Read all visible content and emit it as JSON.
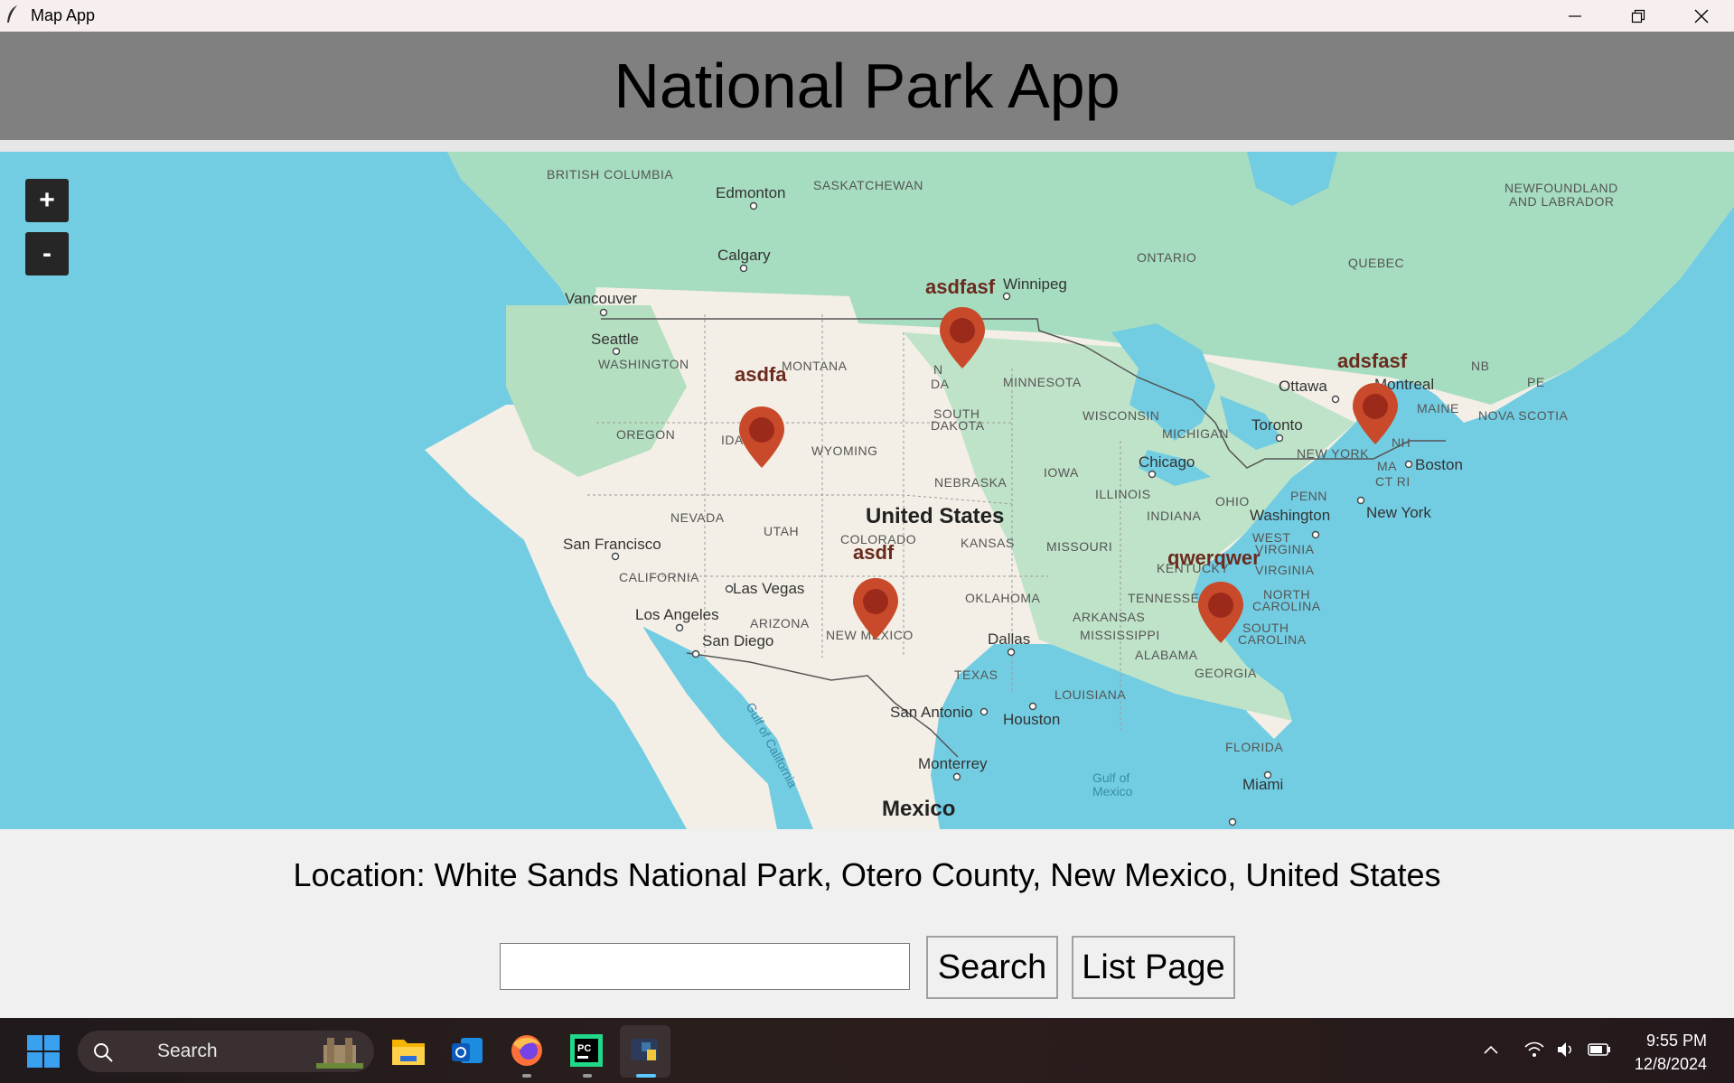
{
  "window": {
    "title": "Map App",
    "controls": [
      "minimize-icon",
      "restore-icon",
      "close-icon"
    ]
  },
  "header": {
    "title": "National Park App"
  },
  "map": {
    "zoom_in": "+",
    "zoom_out": "-",
    "places": {
      "british_columbia": "BRITISH COLUMBIA",
      "saskatchewan": "SASKATCHEWAN",
      "edmonton": "Edmonton",
      "calgary": "Calgary",
      "winnipeg": "Winnipeg",
      "vancouver": "Vancouver",
      "seattle": "Seattle",
      "washington": "WASHINGTON",
      "montana": "MONTANA",
      "oregon": "OREGON",
      "idaho": "IDA",
      "wyoming": "WYOMING",
      "nevada": "NEVADA",
      "utah": "UTAH",
      "colorado": "COLORADO",
      "california": "CALIFORNIA",
      "arizona": "ARIZONA",
      "new_mexico": "NEW MEXICO",
      "san_francisco": "San Francisco",
      "las_vegas": "Las Vegas",
      "los_angeles": "Los Angeles",
      "san_diego": "San Diego",
      "united_states": "United States",
      "north_dakota_n": "N",
      "north_dakota_da": "DA",
      "south_dakota": "SOUTH DAKOTA",
      "nebraska": "NEBRASKA",
      "kansas": "KANSAS",
      "oklahoma": "OKLAHOMA",
      "texas": "TEXAS",
      "dallas": "Dallas",
      "san_antonio": "San Antonio",
      "houston": "Houston",
      "monterrey": "Monterrey",
      "mexico": "Mexico",
      "gulf_of_california": "Gulf of California",
      "gulf_of_mexico_1": "Gulf of",
      "gulf_of_mexico_2": "Mexico",
      "minnesota": "MINNESOTA",
      "iowa": "IOWA",
      "missouri": "MISSOURI",
      "arkansas": "ARKANSAS",
      "louisiana": "LOUISIANA",
      "mississippi": "MISSISSIPPI",
      "alabama": "ALABAMA",
      "georgia": "GEORGIA",
      "florida": "FLORIDA",
      "miami": "Miami",
      "tennessee": "TENNESSEE",
      "kentucky": "KENTUCKY",
      "north_carolina_1": "NORTH",
      "north_carolina_2": "CAROLINA",
      "south_carolina_1": "SOUTH",
      "south_carolina_2": "CAROLINA",
      "virginia": "VIRGINIA",
      "west_virginia": "WEST",
      "west_virginia_2": "VIRGINIA",
      "washington_dc": "Washington",
      "wisconsin": "WISCONSIN",
      "michigan": "MICHIGAN",
      "illinois": "ILLINOIS",
      "indiana": "INDIANA",
      "ohio": "OHIO",
      "chicago": "Chicago",
      "penn": "PENN",
      "new_york_state": "NEW YORK",
      "new_york_city": "New York",
      "boston": "Boston",
      "ma": "MA",
      "ct_ri": "CT RI",
      "nh": "NH",
      "maine": "MAINE",
      "toronto": "Toronto",
      "ottawa": "Ottawa",
      "montreal": "Montreal",
      "ontario": "ONTARIO",
      "quebec": "QUEBEC",
      "nb": "NB",
      "pe": "PE",
      "nova_scotia": "NOVA SCOTIA",
      "newfoundland_1": "NEWFOUNDLAND",
      "newfoundland_2": "AND LABRADOR"
    },
    "markers": [
      {
        "label": "asdfasf"
      },
      {
        "label": "asdfa"
      },
      {
        "label": "adsfasf"
      },
      {
        "label": "asdf"
      },
      {
        "label": "qwerqwer"
      }
    ],
    "colors": {
      "water": "#72cde2",
      "land": "#f3efe6",
      "forest": "#a6dcc0",
      "marker": "#c94a2a",
      "marker_dot": "#9c2a1a"
    }
  },
  "location_text": "Location: White Sands National Park, Otero County, New Mexico, United States",
  "search": {
    "value": "",
    "button_label": "Search"
  },
  "list_button_label": "List Page",
  "taskbar": {
    "search_label": "Search",
    "apps": [
      "windows-start-icon",
      "file-explorer-icon",
      "outlook-icon",
      "firefox-icon",
      "pycharm-icon",
      "python-icon"
    ],
    "time": "9:55 PM",
    "date": "12/8/2024"
  }
}
